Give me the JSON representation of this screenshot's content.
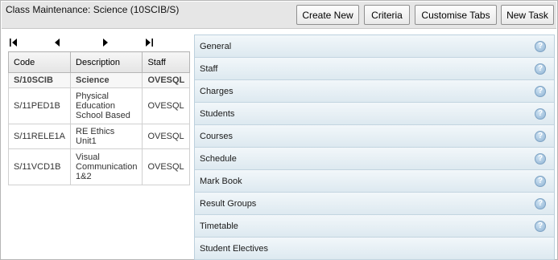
{
  "header": {
    "title": "Class Maintenance: Science (10SCIB/S)",
    "buttons": {
      "create_new": "Create New",
      "criteria": "Criteria",
      "customise_tabs": "Customise Tabs",
      "new_task": "New Task"
    }
  },
  "pager": {
    "icons": [
      "first-page-icon",
      "previous-page-icon",
      "next-page-icon",
      "last-page-icon"
    ]
  },
  "table": {
    "columns": [
      "Code",
      "Description",
      "Staff"
    ],
    "rows": [
      {
        "code": "S/10SCIB",
        "description": "Science",
        "staff": "OVESQL",
        "selected": true
      },
      {
        "code": "S/11PED1B",
        "description": "Physical Education School Based",
        "staff": "OVESQL"
      },
      {
        "code": "S/11RELE1A",
        "description": "RE Ethics Unit1",
        "staff": "OVESQL"
      },
      {
        "code": "S/11VCD1B",
        "description": "Visual Communication 1&2",
        "staff": "OVESQL"
      }
    ]
  },
  "accordion": {
    "help_glyph": "?",
    "items": [
      {
        "label": "General",
        "help": true
      },
      {
        "label": "Staff",
        "help": true
      },
      {
        "label": "Charges",
        "help": true
      },
      {
        "label": "Students",
        "help": true
      },
      {
        "label": "Courses",
        "help": true
      },
      {
        "label": "Schedule",
        "help": true
      },
      {
        "label": "Mark Book",
        "help": true
      },
      {
        "label": "Result Groups",
        "help": true
      },
      {
        "label": "Timetable",
        "help": true
      },
      {
        "label": "Student Electives",
        "help": false
      }
    ]
  },
  "colors": {
    "header_bg": "#e6e6e6",
    "accordion_bg": "#dde9f0",
    "help_icon": "#8fb3d3"
  }
}
